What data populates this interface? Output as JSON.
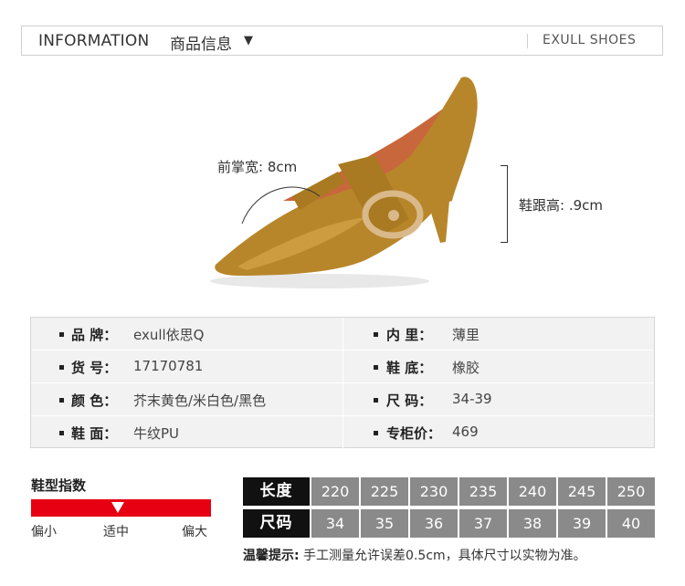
{
  "header": {
    "title_en": "INFORMATION",
    "title_cn": "商品信息",
    "arrow": "▼",
    "brand": "EXULL SHOES"
  },
  "shoe": {
    "forefoot_width": "前掌宽: 8cm",
    "heel_height": "鞋跟高: .9cm",
    "colors": {
      "upper": "#b8862a",
      "lining": "#c9673c",
      "buckle": "#d9b98a"
    }
  },
  "info": {
    "rows": [
      {
        "left_label": "品    牌：",
        "left_value": "exull依思Q",
        "right_label": "内    里：",
        "right_value": "薄里"
      },
      {
        "left_label": "货    号：",
        "left_value": "17170781",
        "right_label": "鞋    底：",
        "right_value": "橡胶"
      },
      {
        "left_label": "颜    色：",
        "left_value": "芥末黄色/米白色/黑色",
        "right_label": "尺    码：",
        "right_value": "34-39"
      },
      {
        "left_label": "鞋    面：",
        "left_value": "牛纹PU",
        "right_label": "专柜价：",
        "right_value": "469"
      }
    ]
  },
  "fit": {
    "title": "鞋型指数",
    "small": "偏小",
    "normal": "适中",
    "large": "偏大",
    "bar_color": "#e60012"
  },
  "sizes": {
    "length_label": "长度",
    "size_label": "尺码",
    "lengths": [
      "220",
      "225",
      "230",
      "235",
      "240",
      "245",
      "250"
    ],
    "sizes": [
      "34",
      "35",
      "36",
      "37",
      "38",
      "39",
      "40"
    ]
  },
  "note": {
    "prefix": "温馨提示:",
    "text": " 手工测量允许误差0.5cm，具体尺寸以实物为准。"
  }
}
